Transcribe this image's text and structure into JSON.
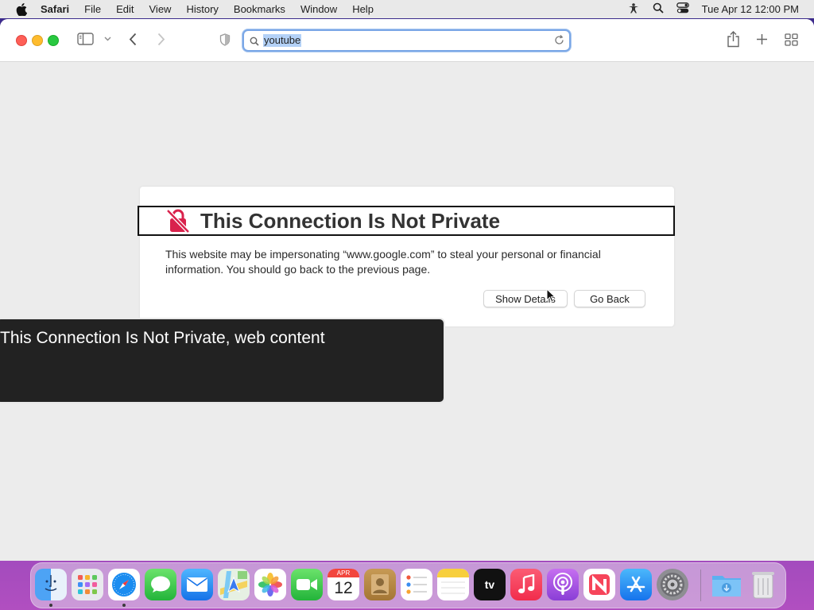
{
  "menubar": {
    "app": "Safari",
    "items": [
      "File",
      "Edit",
      "View",
      "History",
      "Bookmarks",
      "Window",
      "Help"
    ],
    "clock": "Tue Apr 12  12:00 PM"
  },
  "toolbar": {
    "url_text": "youtube"
  },
  "page": {
    "title": "This Connection Is Not Private",
    "message": "This website may be impersonating “www.google.com” to steal your personal or financial information. You should go back to the previous page.",
    "show_details": "Show Details",
    "go_back": "Go Back"
  },
  "voiceover": {
    "caption": "This Connection Is Not Private, web content"
  },
  "dock": {
    "calendar_month": "APR",
    "calendar_day": "12",
    "tv_label": "tv"
  },
  "colors": {
    "accent": "#7aa7e6",
    "warning": "#d9224c",
    "close": "#fe5f57",
    "minimize": "#febc2e",
    "zoom": "#28c840"
  }
}
